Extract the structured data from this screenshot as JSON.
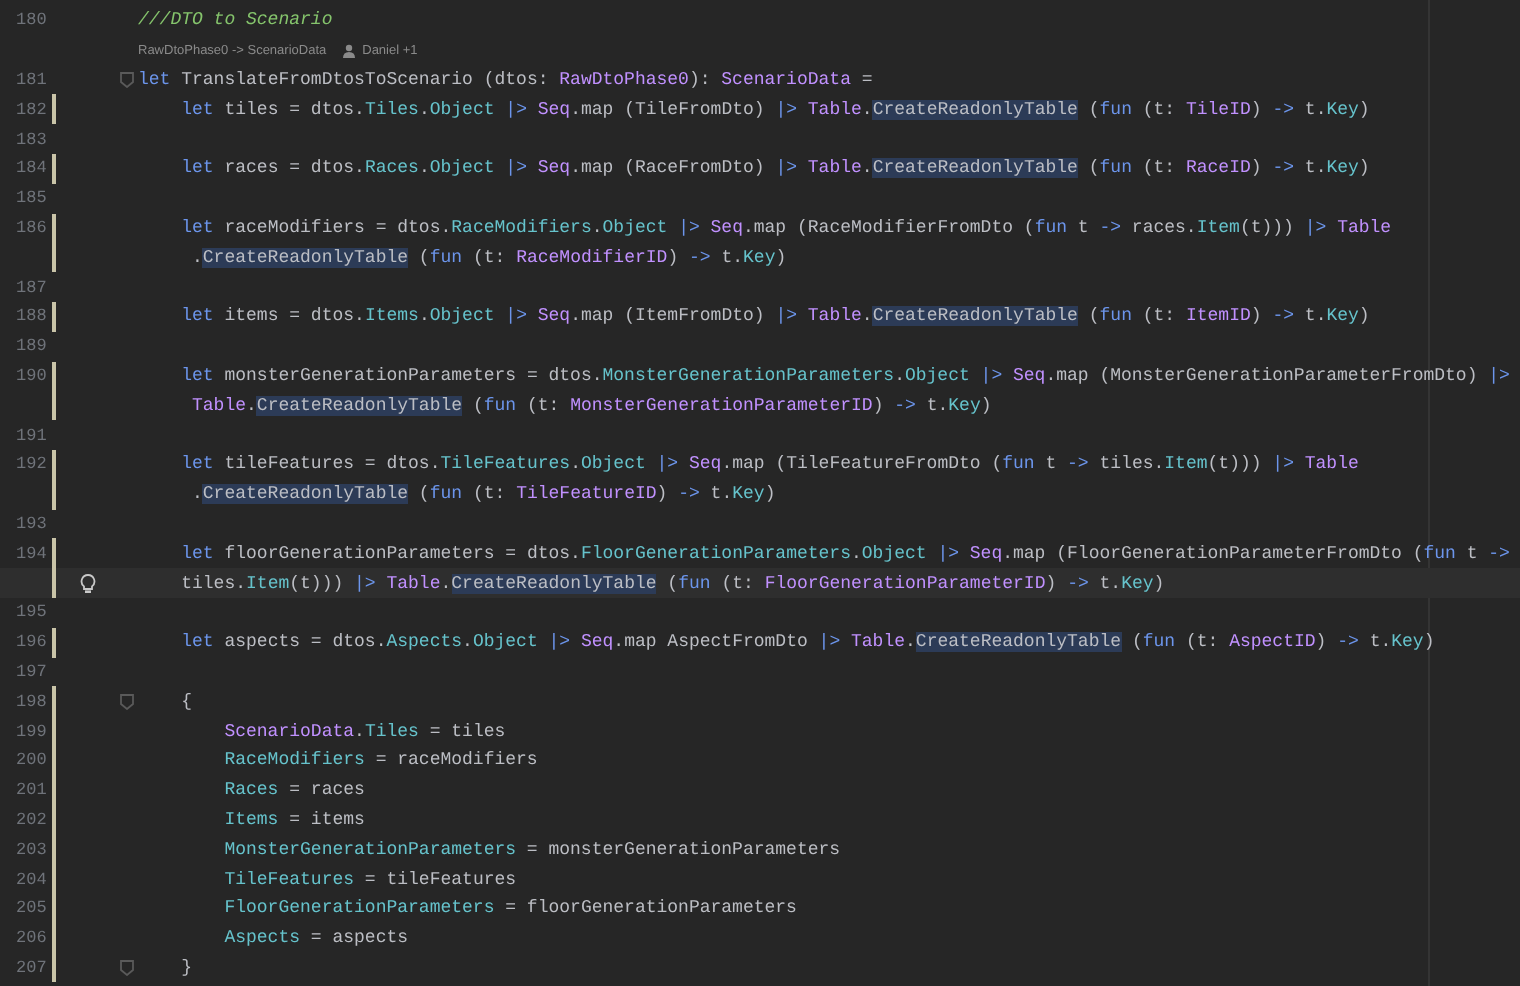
{
  "lines": [
    {
      "kind": "code",
      "number": "180",
      "changed": false,
      "fold": false,
      "current": false,
      "tokens": [
        {
          "text": "///DTO to Scenario",
          "kind": "comment"
        }
      ]
    },
    {
      "kind": "hint",
      "signature": "RawDtoPhase0 -> ScenarioData",
      "author": "Daniel +1"
    },
    {
      "kind": "code",
      "number": "181",
      "changed": false,
      "fold": true,
      "current": false,
      "tokens": [
        {
          "text": "let ",
          "kind": "keyword"
        },
        {
          "text": "TranslateFromDtosToScenario (dtos: ",
          "kind": "plain"
        },
        {
          "text": "RawDtoPhase0",
          "kind": "type"
        },
        {
          "text": "): ",
          "kind": "plain"
        },
        {
          "text": "ScenarioData",
          "kind": "type"
        },
        {
          "text": " =",
          "kind": "plain"
        }
      ]
    },
    {
      "kind": "code",
      "number": "182",
      "changed": true,
      "fold": false,
      "current": false,
      "tokens": [
        {
          "text": "    let ",
          "kind": "keyword"
        },
        {
          "text": "tiles = dtos.",
          "kind": "plain"
        },
        {
          "text": "Tiles",
          "kind": "member"
        },
        {
          "text": ".",
          "kind": "plain"
        },
        {
          "text": "Object",
          "kind": "member"
        },
        {
          "text": " |> ",
          "kind": "operator"
        },
        {
          "text": "Seq",
          "kind": "type"
        },
        {
          "text": ".map (TileFromDto) ",
          "kind": "plain"
        },
        {
          "text": "|> ",
          "kind": "operator"
        },
        {
          "text": "Table",
          "kind": "type"
        },
        {
          "text": ".",
          "kind": "plain"
        },
        {
          "text": "CreateReadonlyTable",
          "kind": "usage"
        },
        {
          "text": " (",
          "kind": "plain"
        },
        {
          "text": "fun",
          "kind": "keyword"
        },
        {
          "text": " (t: ",
          "kind": "plain"
        },
        {
          "text": "TileID",
          "kind": "type"
        },
        {
          "text": ") ",
          "kind": "plain"
        },
        {
          "text": "->",
          "kind": "operator"
        },
        {
          "text": " t.",
          "kind": "plain"
        },
        {
          "text": "Key",
          "kind": "member"
        },
        {
          "text": ")",
          "kind": "plain"
        }
      ]
    },
    {
      "kind": "code",
      "number": "183",
      "changed": false,
      "fold": false,
      "current": false
    },
    {
      "kind": "code",
      "number": "184",
      "changed": true,
      "fold": false,
      "current": false,
      "tokens": [
        {
          "text": "    let ",
          "kind": "keyword"
        },
        {
          "text": "races = dtos.",
          "kind": "plain"
        },
        {
          "text": "Races",
          "kind": "member"
        },
        {
          "text": ".",
          "kind": "plain"
        },
        {
          "text": "Object",
          "kind": "member"
        },
        {
          "text": " |> ",
          "kind": "operator"
        },
        {
          "text": "Seq",
          "kind": "type"
        },
        {
          "text": ".map (RaceFromDto) ",
          "kind": "plain"
        },
        {
          "text": "|> ",
          "kind": "operator"
        },
        {
          "text": "Table",
          "kind": "type"
        },
        {
          "text": ".",
          "kind": "plain"
        },
        {
          "text": "CreateReadonlyTable",
          "kind": "usage"
        },
        {
          "text": " (",
          "kind": "plain"
        },
        {
          "text": "fun",
          "kind": "keyword"
        },
        {
          "text": " (t: ",
          "kind": "plain"
        },
        {
          "text": "RaceID",
          "kind": "type"
        },
        {
          "text": ") ",
          "kind": "plain"
        },
        {
          "text": "->",
          "kind": "operator"
        },
        {
          "text": " t.",
          "kind": "plain"
        },
        {
          "text": "Key",
          "kind": "member"
        },
        {
          "text": ")",
          "kind": "plain"
        }
      ]
    },
    {
      "kind": "code",
      "number": "185",
      "changed": false,
      "fold": false,
      "current": false
    },
    {
      "kind": "code",
      "number": "186",
      "changed": true,
      "fold": false,
      "current": false,
      "tokens": [
        {
          "text": "    let ",
          "kind": "keyword"
        },
        {
          "text": "raceModifiers = dtos.",
          "kind": "plain"
        },
        {
          "text": "RaceModifiers",
          "kind": "member"
        },
        {
          "text": ".",
          "kind": "plain"
        },
        {
          "text": "Object",
          "kind": "member"
        },
        {
          "text": " |> ",
          "kind": "operator"
        },
        {
          "text": "Seq",
          "kind": "type"
        },
        {
          "text": ".map (RaceModifierFromDto (",
          "kind": "plain"
        },
        {
          "text": "fun",
          "kind": "keyword"
        },
        {
          "text": " t ",
          "kind": "plain"
        },
        {
          "text": "->",
          "kind": "operator"
        },
        {
          "text": " races.",
          "kind": "plain"
        },
        {
          "text": "Item",
          "kind": "member"
        },
        {
          "text": "(t))) ",
          "kind": "plain"
        },
        {
          "text": "|> ",
          "kind": "operator"
        },
        {
          "text": "Table",
          "kind": "type"
        }
      ]
    },
    {
      "kind": "code",
      "changed": true,
      "fold": false,
      "current": false,
      "tokens": [
        {
          "text": "     .",
          "kind": "plain"
        },
        {
          "text": "CreateReadonlyTable",
          "kind": "usage"
        },
        {
          "text": " (",
          "kind": "plain"
        },
        {
          "text": "fun",
          "kind": "keyword"
        },
        {
          "text": " (t: ",
          "kind": "plain"
        },
        {
          "text": "RaceModifierID",
          "kind": "type"
        },
        {
          "text": ") ",
          "kind": "plain"
        },
        {
          "text": "->",
          "kind": "operator"
        },
        {
          "text": " t.",
          "kind": "plain"
        },
        {
          "text": "Key",
          "kind": "member"
        },
        {
          "text": ")",
          "kind": "plain"
        }
      ]
    },
    {
      "kind": "code",
      "number": "187",
      "changed": false,
      "fold": false,
      "current": false
    },
    {
      "kind": "code",
      "number": "188",
      "changed": true,
      "fold": false,
      "current": false,
      "tokens": [
        {
          "text": "    let ",
          "kind": "keyword"
        },
        {
          "text": "items = dtos.",
          "kind": "plain"
        },
        {
          "text": "Items",
          "kind": "member"
        },
        {
          "text": ".",
          "kind": "plain"
        },
        {
          "text": "Object",
          "kind": "member"
        },
        {
          "text": " |> ",
          "kind": "operator"
        },
        {
          "text": "Seq",
          "kind": "type"
        },
        {
          "text": ".map (ItemFromDto) ",
          "kind": "plain"
        },
        {
          "text": "|> ",
          "kind": "operator"
        },
        {
          "text": "Table",
          "kind": "type"
        },
        {
          "text": ".",
          "kind": "plain"
        },
        {
          "text": "CreateReadonlyTable",
          "kind": "usage"
        },
        {
          "text": " (",
          "kind": "plain"
        },
        {
          "text": "fun",
          "kind": "keyword"
        },
        {
          "text": " (t: ",
          "kind": "plain"
        },
        {
          "text": "ItemID",
          "kind": "type"
        },
        {
          "text": ") ",
          "kind": "plain"
        },
        {
          "text": "->",
          "kind": "operator"
        },
        {
          "text": " t.",
          "kind": "plain"
        },
        {
          "text": "Key",
          "kind": "member"
        },
        {
          "text": ")",
          "kind": "plain"
        }
      ]
    },
    {
      "kind": "code",
      "number": "189",
      "changed": false,
      "fold": false,
      "current": false
    },
    {
      "kind": "code",
      "number": "190",
      "changed": true,
      "fold": false,
      "current": false,
      "tokens": [
        {
          "text": "    let ",
          "kind": "keyword"
        },
        {
          "text": "monsterGenerationParameters = dtos.",
          "kind": "plain"
        },
        {
          "text": "MonsterGenerationParameters",
          "kind": "member"
        },
        {
          "text": ".",
          "kind": "plain"
        },
        {
          "text": "Object",
          "kind": "member"
        },
        {
          "text": " |> ",
          "kind": "operator"
        },
        {
          "text": "Seq",
          "kind": "type"
        },
        {
          "text": ".map (MonsterGenerationParameterFromDto) ",
          "kind": "plain"
        },
        {
          "text": "|>",
          "kind": "operator"
        }
      ]
    },
    {
      "kind": "code",
      "changed": true,
      "fold": false,
      "current": false,
      "tokens": [
        {
          "text": "     Table",
          "kind": "type"
        },
        {
          "text": ".",
          "kind": "plain"
        },
        {
          "text": "CreateReadonlyTable",
          "kind": "usage"
        },
        {
          "text": " (",
          "kind": "plain"
        },
        {
          "text": "fun",
          "kind": "keyword"
        },
        {
          "text": " (t: ",
          "kind": "plain"
        },
        {
          "text": "MonsterGenerationParameterID",
          "kind": "type"
        },
        {
          "text": ") ",
          "kind": "plain"
        },
        {
          "text": "->",
          "kind": "operator"
        },
        {
          "text": " t.",
          "kind": "plain"
        },
        {
          "text": "Key",
          "kind": "member"
        },
        {
          "text": ")",
          "kind": "plain"
        }
      ]
    },
    {
      "kind": "code",
      "number": "191",
      "changed": false,
      "fold": false,
      "current": false
    },
    {
      "kind": "code",
      "number": "192",
      "changed": true,
      "fold": false,
      "current": false,
      "tokens": [
        {
          "text": "    let ",
          "kind": "keyword"
        },
        {
          "text": "tileFeatures = dtos.",
          "kind": "plain"
        },
        {
          "text": "TileFeatures",
          "kind": "member"
        },
        {
          "text": ".",
          "kind": "plain"
        },
        {
          "text": "Object",
          "kind": "member"
        },
        {
          "text": " |> ",
          "kind": "operator"
        },
        {
          "text": "Seq",
          "kind": "type"
        },
        {
          "text": ".map (TileFeatureFromDto (",
          "kind": "plain"
        },
        {
          "text": "fun",
          "kind": "keyword"
        },
        {
          "text": " t ",
          "kind": "plain"
        },
        {
          "text": "->",
          "kind": "operator"
        },
        {
          "text": " tiles.",
          "kind": "plain"
        },
        {
          "text": "Item",
          "kind": "member"
        },
        {
          "text": "(t))) ",
          "kind": "plain"
        },
        {
          "text": "|> ",
          "kind": "operator"
        },
        {
          "text": "Table",
          "kind": "type"
        }
      ]
    },
    {
      "kind": "code",
      "changed": true,
      "fold": false,
      "current": false,
      "tokens": [
        {
          "text": "     .",
          "kind": "plain"
        },
        {
          "text": "CreateReadonlyTable",
          "kind": "usage"
        },
        {
          "text": " (",
          "kind": "plain"
        },
        {
          "text": "fun",
          "kind": "keyword"
        },
        {
          "text": " (t: ",
          "kind": "plain"
        },
        {
          "text": "TileFeatureID",
          "kind": "type"
        },
        {
          "text": ") ",
          "kind": "plain"
        },
        {
          "text": "->",
          "kind": "operator"
        },
        {
          "text": " t.",
          "kind": "plain"
        },
        {
          "text": "Key",
          "kind": "member"
        },
        {
          "text": ")",
          "kind": "plain"
        }
      ]
    },
    {
      "kind": "code",
      "number": "193",
      "changed": false,
      "fold": false,
      "current": false
    },
    {
      "kind": "code",
      "number": "194",
      "changed": true,
      "fold": false,
      "current": false,
      "tokens": [
        {
          "text": "    let ",
          "kind": "keyword"
        },
        {
          "text": "floorGenerationParameters = dtos.",
          "kind": "plain"
        },
        {
          "text": "FloorGenerationParameters",
          "kind": "member"
        },
        {
          "text": ".",
          "kind": "plain"
        },
        {
          "text": "Object",
          "kind": "member"
        },
        {
          "text": " |> ",
          "kind": "operator"
        },
        {
          "text": "Seq",
          "kind": "type"
        },
        {
          "text": ".map (FloorGenerationParameterFromDto (",
          "kind": "plain"
        },
        {
          "text": "fun",
          "kind": "keyword"
        },
        {
          "text": " t ",
          "kind": "plain"
        },
        {
          "text": "->",
          "kind": "operator"
        }
      ]
    },
    {
      "kind": "code",
      "changed": true,
      "fold": false,
      "current": true,
      "tokens": [
        {
          "text": "    tiles.",
          "kind": "plain"
        },
        {
          "text": "Item",
          "kind": "member"
        },
        {
          "text": "(t))) ",
          "kind": "plain"
        },
        {
          "text": "|> ",
          "kind": "operator"
        },
        {
          "text": "Table",
          "kind": "type"
        },
        {
          "text": ".",
          "kind": "plain"
        },
        {
          "text": "CreateReadonlyTable",
          "kind": "usage"
        },
        {
          "text": " (",
          "kind": "plain"
        },
        {
          "text": "fun",
          "kind": "keyword"
        },
        {
          "text": " (t: ",
          "kind": "plain"
        },
        {
          "text": "FloorGenerationParameterID",
          "kind": "type"
        },
        {
          "text": ") ",
          "kind": "plain"
        },
        {
          "text": "->",
          "kind": "operator"
        },
        {
          "text": " t.",
          "kind": "plain"
        },
        {
          "text": "Key",
          "kind": "member"
        },
        {
          "text": ")",
          "kind": "plain"
        }
      ]
    },
    {
      "kind": "code",
      "number": "195",
      "changed": false,
      "fold": false,
      "current": false
    },
    {
      "kind": "code",
      "number": "196",
      "changed": true,
      "fold": false,
      "current": false,
      "tokens": [
        {
          "text": "    let ",
          "kind": "keyword"
        },
        {
          "text": "aspects = dtos.",
          "kind": "plain"
        },
        {
          "text": "Aspects",
          "kind": "member"
        },
        {
          "text": ".",
          "kind": "plain"
        },
        {
          "text": "Object",
          "kind": "member"
        },
        {
          "text": " |> ",
          "kind": "operator"
        },
        {
          "text": "Seq",
          "kind": "type"
        },
        {
          "text": ".map AspectFromDto ",
          "kind": "plain"
        },
        {
          "text": "|> ",
          "kind": "operator"
        },
        {
          "text": "Table",
          "kind": "type"
        },
        {
          "text": ".",
          "kind": "plain"
        },
        {
          "text": "CreateReadonlyTable",
          "kind": "usage"
        },
        {
          "text": " (",
          "kind": "plain"
        },
        {
          "text": "fun",
          "kind": "keyword"
        },
        {
          "text": " (t: ",
          "kind": "plain"
        },
        {
          "text": "AspectID",
          "kind": "type"
        },
        {
          "text": ") ",
          "kind": "plain"
        },
        {
          "text": "->",
          "kind": "operator"
        },
        {
          "text": " t.",
          "kind": "plain"
        },
        {
          "text": "Key",
          "kind": "member"
        },
        {
          "text": ")",
          "kind": "plain"
        }
      ]
    },
    {
      "kind": "code",
      "number": "197",
      "changed": false,
      "fold": false,
      "current": false
    },
    {
      "kind": "code",
      "number": "198",
      "changed": true,
      "fold": true,
      "current": false,
      "tokens": [
        {
          "text": "    {",
          "kind": "plain"
        }
      ]
    },
    {
      "kind": "code",
      "number": "199",
      "changed": true,
      "fold": false,
      "current": false,
      "tokens": [
        {
          "text": "        ScenarioData",
          "kind": "type"
        },
        {
          "text": ".",
          "kind": "plain"
        },
        {
          "text": "Tiles",
          "kind": "member"
        },
        {
          "text": " = tiles",
          "kind": "plain"
        }
      ]
    },
    {
      "kind": "code",
      "number": "200",
      "changed": true,
      "fold": false,
      "current": false,
      "tokens": [
        {
          "text": "        RaceModifiers",
          "kind": "member"
        },
        {
          "text": " = raceModifiers",
          "kind": "plain"
        }
      ]
    },
    {
      "kind": "code",
      "number": "201",
      "changed": true,
      "fold": false,
      "current": false,
      "tokens": [
        {
          "text": "        Races",
          "kind": "member"
        },
        {
          "text": " = races",
          "kind": "plain"
        }
      ]
    },
    {
      "kind": "code",
      "number": "202",
      "changed": true,
      "fold": false,
      "current": false,
      "tokens": [
        {
          "text": "        Items",
          "kind": "member"
        },
        {
          "text": " = items",
          "kind": "plain"
        }
      ]
    },
    {
      "kind": "code",
      "number": "203",
      "changed": true,
      "fold": false,
      "current": false,
      "tokens": [
        {
          "text": "        MonsterGenerationParameters",
          "kind": "member"
        },
        {
          "text": " = monsterGenerationParameters",
          "kind": "plain"
        }
      ]
    },
    {
      "kind": "code",
      "number": "204",
      "changed": true,
      "fold": false,
      "current": false,
      "tokens": [
        {
          "text": "        TileFeatures",
          "kind": "member"
        },
        {
          "text": " = tileFeatures",
          "kind": "plain"
        }
      ]
    },
    {
      "kind": "code",
      "number": "205",
      "changed": true,
      "fold": false,
      "current": false,
      "tokens": [
        {
          "text": "        FloorGenerationParameters",
          "kind": "member"
        },
        {
          "text": " = floorGenerationParameters",
          "kind": "plain"
        }
      ]
    },
    {
      "kind": "code",
      "number": "206",
      "changed": true,
      "fold": false,
      "current": false,
      "tokens": [
        {
          "text": "        Aspects",
          "kind": "member"
        },
        {
          "text": " = aspects",
          "kind": "plain"
        }
      ]
    },
    {
      "kind": "code",
      "number": "207",
      "changed": true,
      "fold": true,
      "current": false,
      "tokens": [
        {
          "text": "    }",
          "kind": "plain"
        }
      ]
    }
  ]
}
